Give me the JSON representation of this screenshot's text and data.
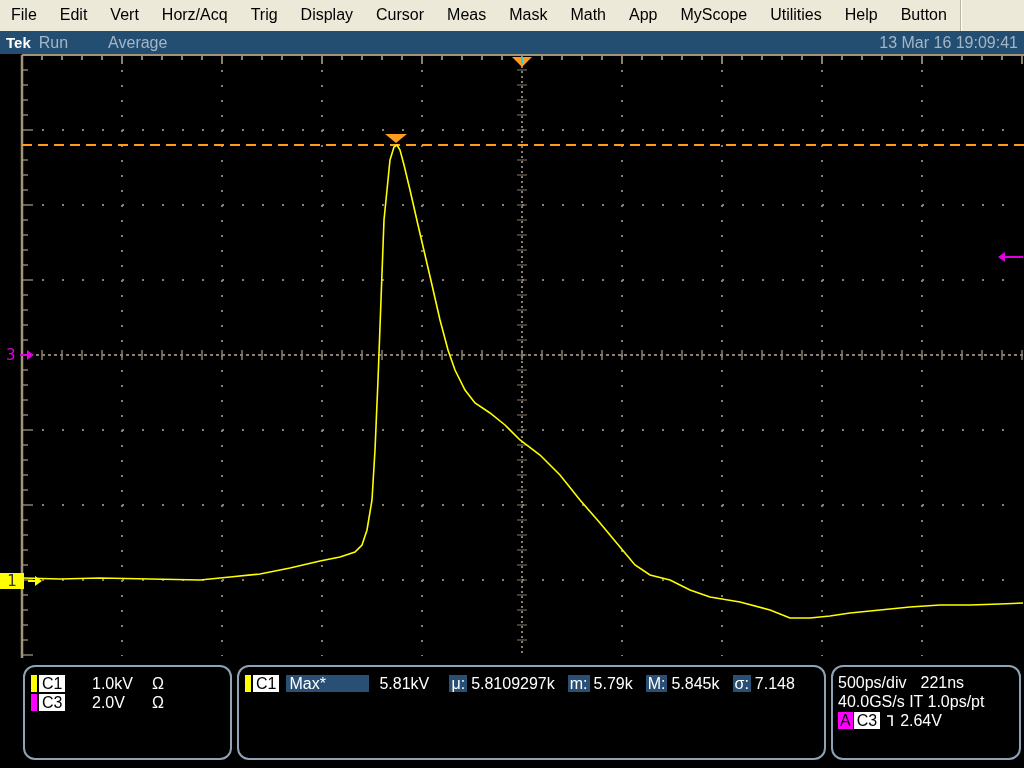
{
  "menu": [
    {
      "label": "File"
    },
    {
      "label": "Edit"
    },
    {
      "label": "Vert"
    },
    {
      "label": "Horz/Acq"
    },
    {
      "label": "Trig"
    },
    {
      "label": "Display"
    },
    {
      "label": "Cursor"
    },
    {
      "label": "Meas"
    },
    {
      "label": "Mask"
    },
    {
      "label": "Math"
    },
    {
      "label": "App"
    },
    {
      "label": "MyScope"
    },
    {
      "label": "Utilities"
    },
    {
      "label": "Help"
    },
    {
      "label": "Button"
    }
  ],
  "status_bar": {
    "brand": "Tek",
    "run_state": "Run",
    "acquisition_mode": "Average",
    "datetime": "13 Mar 16 19:09:41"
  },
  "display": {
    "channel_markers": [
      {
        "label": "3",
        "color": "#e000e0",
        "selected": false
      },
      {
        "label": "1",
        "color": "#ffff00",
        "selected": true
      }
    ]
  },
  "channels": [
    {
      "name": "C1",
      "color": "#ffff00",
      "scale": "1.0kV",
      "termination": "Ω"
    },
    {
      "name": "C3",
      "color": "#ff00ff",
      "scale": "2.0V",
      "termination": "Ω"
    }
  ],
  "measurements": [
    {
      "source": "C1",
      "color": "#ffff00",
      "name": "Max*",
      "value": "5.81kV",
      "stats": [
        {
          "label": "μ:",
          "value": "5.8109297k"
        },
        {
          "label": "m:",
          "value": "5.79k"
        },
        {
          "label": "M:",
          "value": "5.845k"
        },
        {
          "label": "σ:",
          "value": "7.148"
        }
      ]
    }
  ],
  "horizontal": {
    "scale": "500ps/div",
    "position": "221ns",
    "sample_rate": "40.0GS/s IT 1.0ps/pt"
  },
  "trigger": {
    "type": "A",
    "source": "C3",
    "falling_edge": true,
    "level": "2.64V"
  }
}
